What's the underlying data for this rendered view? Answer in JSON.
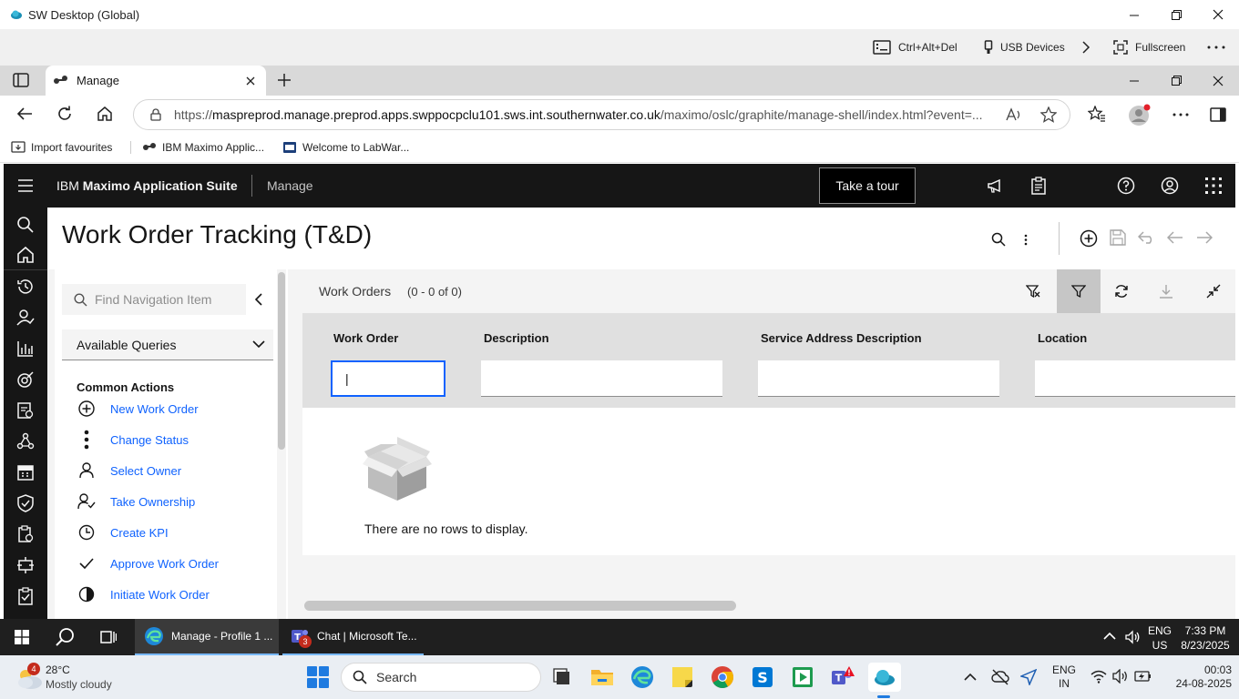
{
  "window": {
    "title": "SW Desktop (Global)"
  },
  "remote_toolbar": {
    "ctrl_alt_del": "Ctrl+Alt+Del",
    "usb_devices": "USB Devices",
    "fullscreen": "Fullscreen"
  },
  "browser": {
    "tab_label": "Manage",
    "url_prefix": "https://",
    "url_host": "maspreprod.manage.preprod.apps.swppocpclu101.sws.int.southernwater.co.uk",
    "url_path": "/maximo/oslc/graphite/manage-shell/index.html?event=...",
    "favourites": [
      "Import favourites",
      "IBM Maximo Applic...",
      "Welcome to LabWar..."
    ]
  },
  "app": {
    "brand_prefix": "IBM",
    "brand_name": "Maximo Application Suite",
    "module": "Manage",
    "tour_button": "Take a tour",
    "page_title": "Work Order Tracking (T&D)",
    "find_placeholder": "Find Navigation Item",
    "queries_label": "Available Queries",
    "common_actions_title": "Common Actions",
    "common_actions": [
      "New Work Order",
      "Change Status",
      "Select Owner",
      "Take Ownership",
      "Create KPI",
      "Approve Work Order",
      "Initiate Work Order"
    ],
    "table": {
      "title": "Work Orders",
      "count": "(0 - 0 of 0)",
      "columns": [
        "Work Order",
        "Description",
        "Service Address Description",
        "Location"
      ],
      "filter_values": [
        "|",
        "",
        "",
        ""
      ],
      "empty_message": "There are no rows to display."
    }
  },
  "remote_taskbar": {
    "tasks": [
      "Manage - Profile 1 ...",
      "Chat | Microsoft Te..."
    ],
    "teams_badge": "3",
    "lang_line1": "ENG",
    "lang_line2": "US",
    "time": "7:33 PM",
    "date": "8/23/2025"
  },
  "taskbar": {
    "weather_temp": "28°C",
    "weather_desc": "Mostly cloudy",
    "weather_badge": "4",
    "search_label": "Search",
    "lang_line1": "ENG",
    "lang_line2": "IN",
    "time": "00:03",
    "date": "24-08-2025"
  }
}
